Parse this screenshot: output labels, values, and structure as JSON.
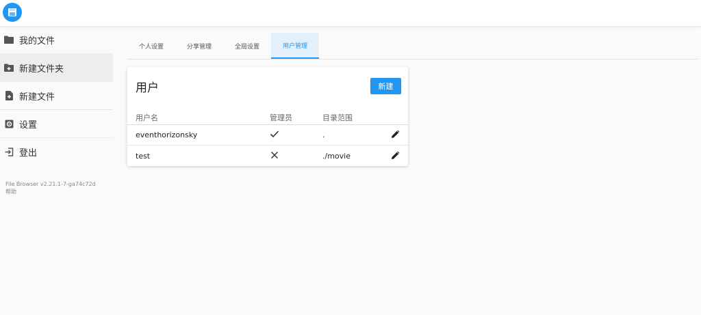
{
  "sidebar": {
    "items": [
      {
        "label": "我的文件",
        "icon": "folder-icon"
      },
      {
        "label": "新建文件夹",
        "icon": "new-folder-icon"
      },
      {
        "label": "新建文件",
        "icon": "new-file-icon"
      },
      {
        "label": "设置",
        "icon": "settings-icon"
      },
      {
        "label": "登出",
        "icon": "logout-icon"
      }
    ],
    "version": "File Browser v2.21.1-7-ga74c72d",
    "help": "帮助"
  },
  "tabs": [
    "个人设置",
    "分享管理",
    "全局设置",
    "用户管理"
  ],
  "card": {
    "title": "用户",
    "new_button": "新建",
    "columns": [
      "用户名",
      "管理员",
      "目录范围"
    ],
    "rows": [
      {
        "username": "eventhorizonsky",
        "admin": true,
        "scope": "."
      },
      {
        "username": "test",
        "admin": false,
        "scope": "./movie"
      }
    ]
  },
  "colors": {
    "accent": "#2196f3",
    "active_tab_bg": "#e3f0fb"
  }
}
